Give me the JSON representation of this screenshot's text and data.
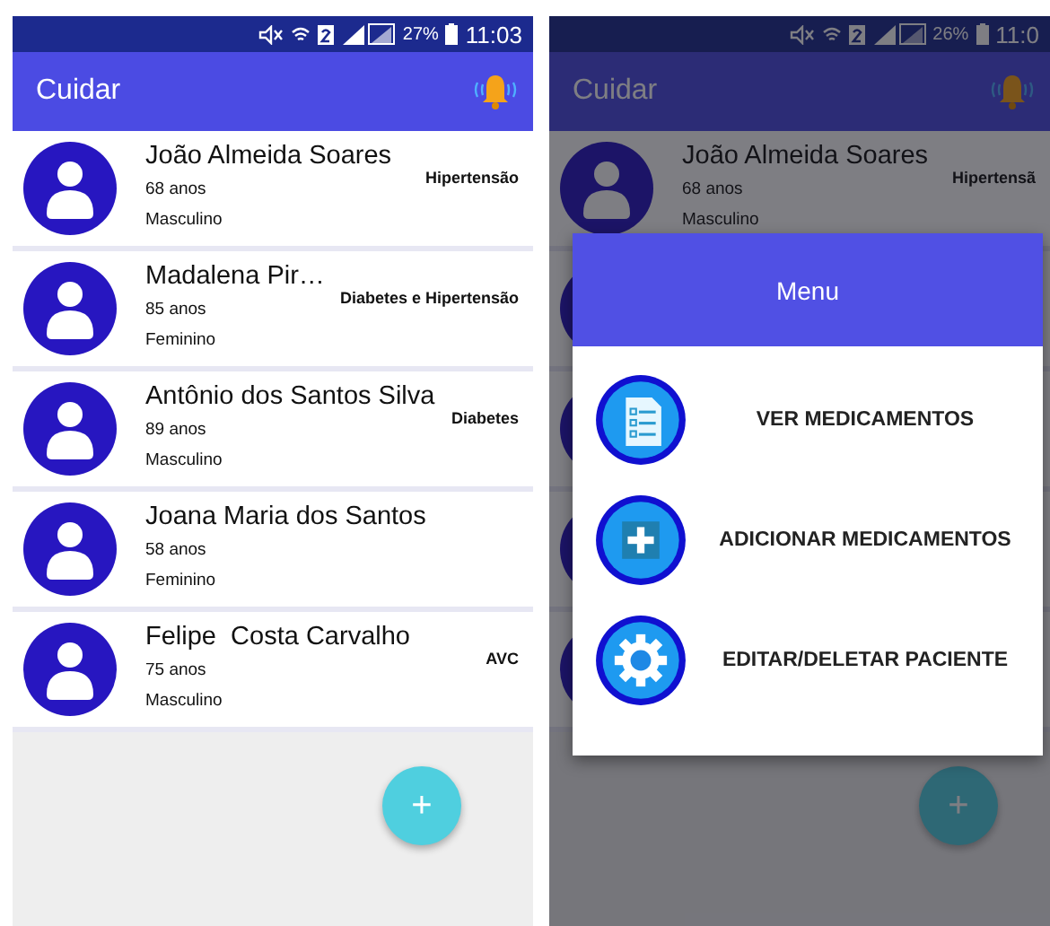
{
  "screens": [
    {
      "status_bar": {
        "battery": "27%",
        "time": "11:03"
      },
      "app_bar": {
        "title": "Cuidar"
      },
      "patients": [
        {
          "name": "João Almeida Soares",
          "age": "68 anos",
          "sex": "Masculino",
          "condition": "Hipertensão"
        },
        {
          "name": "Madalena Pir…",
          "age": "85 anos",
          "sex": "Feminino",
          "condition": "Diabetes e Hipertensão"
        },
        {
          "name": "Antônio dos Santos Silva",
          "age": "89 anos",
          "sex": "Masculino",
          "condition": "Diabetes"
        },
        {
          "name": "Joana Maria dos Santos",
          "age": "58 anos",
          "sex": "Feminino"
        },
        {
          "name": "Felipe  Costa Carvalho",
          "age": "75 anos",
          "sex": "Masculino",
          "condition": "AVC"
        }
      ],
      "fab": {
        "label": "+"
      }
    },
    {
      "status_bar": {
        "battery": "26%",
        "time": "11:0"
      },
      "app_bar": {
        "title": "Cuidar"
      },
      "patients": [
        {
          "name": "João Almeida Soares",
          "age": "68 anos",
          "sex": "Masculino",
          "condition": "Hipertensã"
        }
      ],
      "fab": {
        "label": "+"
      },
      "menu": {
        "title": "Menu",
        "items": [
          {
            "kind": "list",
            "label": "VER MEDICAMENTOS"
          },
          {
            "kind": "add",
            "label": "ADICIONAR MEDICAMENTOS"
          },
          {
            "kind": "settings",
            "label": "EDITAR/DELETAR PACIENTE"
          }
        ]
      }
    }
  ]
}
